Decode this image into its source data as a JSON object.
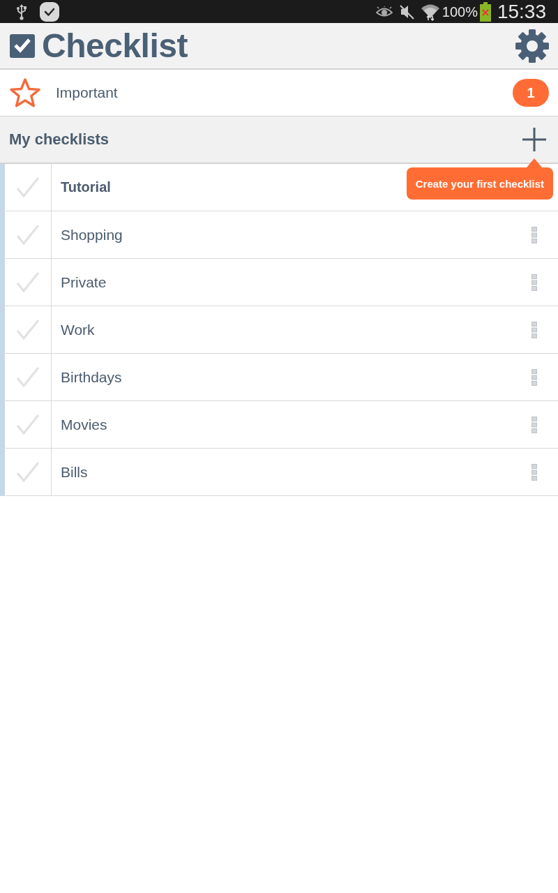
{
  "status_bar": {
    "battery_text": "100%",
    "time": "15:33"
  },
  "app_bar": {
    "title": "Checklist"
  },
  "important": {
    "label": "Important",
    "badge": "1"
  },
  "section": {
    "title": "My checklists"
  },
  "checklists": [
    {
      "name": "Tutorial",
      "kind": "tutorial"
    },
    {
      "name": "Shopping",
      "kind": "list"
    },
    {
      "name": "Private",
      "kind": "list"
    },
    {
      "name": "Work",
      "kind": "list"
    },
    {
      "name": "Birthdays",
      "kind": "list"
    },
    {
      "name": "Movies",
      "kind": "list"
    },
    {
      "name": "Bills",
      "kind": "list"
    }
  ],
  "tooltip": {
    "text": "Create your first checklist"
  }
}
